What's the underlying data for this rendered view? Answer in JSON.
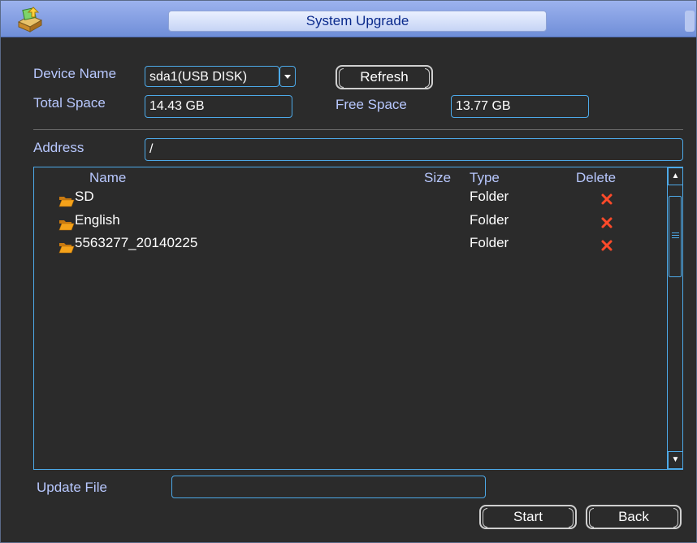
{
  "window": {
    "title": "System Upgrade"
  },
  "device": {
    "name_label": "Device Name",
    "name_value": "sda1(USB DISK)",
    "refresh_label": "Refresh",
    "total_label": "Total Space",
    "total_value": "14.43 GB",
    "free_label": "Free Space",
    "free_value": "13.77 GB"
  },
  "address": {
    "label": "Address",
    "value": "/"
  },
  "file_list": {
    "columns": {
      "name": "Name",
      "size": "Size",
      "type": "Type",
      "delete": "Delete"
    },
    "rows": [
      {
        "name": "SD",
        "size": "",
        "type": "Folder"
      },
      {
        "name": "English",
        "size": "",
        "type": "Folder"
      },
      {
        "name": "5563277_20140225",
        "size": "",
        "type": "Folder"
      }
    ]
  },
  "update": {
    "label": "Update File",
    "value": ""
  },
  "actions": {
    "start_label": "Start",
    "back_label": "Back"
  },
  "colors": {
    "background": "#2b2b2b",
    "label_text": "#b8c8ff",
    "field_border": "#4da9e8",
    "title_text": "#0a2a8c",
    "delete_icon": "#ff4a2a",
    "folder_icon": "#f4a21a"
  },
  "icons": {
    "app": "upgrade-package-icon",
    "row": "folder-icon",
    "delete": "close-x-icon"
  }
}
